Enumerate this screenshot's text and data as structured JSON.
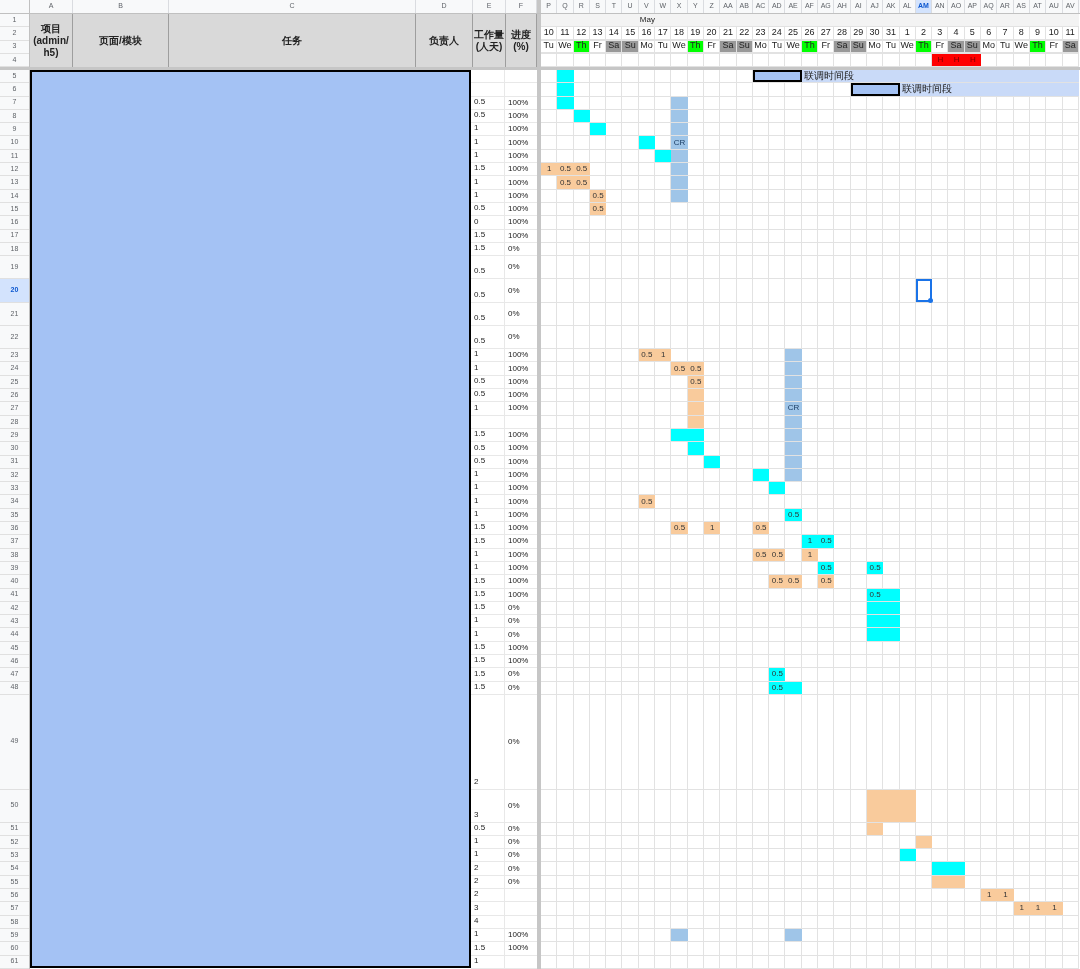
{
  "columns": [
    {
      "label": "A",
      "selected": false
    },
    {
      "label": "B",
      "selected": false
    },
    {
      "label": "C",
      "selected": false
    },
    {
      "label": "D",
      "selected": false
    },
    {
      "label": "E",
      "selected": false
    },
    {
      "label": "F",
      "selected": false
    },
    {
      "label": "P",
      "selected": false
    },
    {
      "label": "Q",
      "selected": false
    },
    {
      "label": "R",
      "selected": false
    },
    {
      "label": "S",
      "selected": false
    },
    {
      "label": "T",
      "selected": false
    },
    {
      "label": "U",
      "selected": false
    },
    {
      "label": "V",
      "selected": false
    },
    {
      "label": "W",
      "selected": false
    },
    {
      "label": "X",
      "selected": false
    },
    {
      "label": "Y",
      "selected": false
    },
    {
      "label": "Z",
      "selected": false
    },
    {
      "label": "AA",
      "selected": false
    },
    {
      "label": "AB",
      "selected": false
    },
    {
      "label": "AC",
      "selected": false
    },
    {
      "label": "AD",
      "selected": false
    },
    {
      "label": "AE",
      "selected": false
    },
    {
      "label": "AF",
      "selected": false
    },
    {
      "label": "AG",
      "selected": false
    },
    {
      "label": "AH",
      "selected": false
    },
    {
      "label": "AI",
      "selected": false
    },
    {
      "label": "AJ",
      "selected": false
    },
    {
      "label": "AK",
      "selected": false
    },
    {
      "label": "AL",
      "selected": false
    },
    {
      "label": "AM",
      "selected": true
    },
    {
      "label": "AN",
      "selected": false
    },
    {
      "label": "AO",
      "selected": false
    },
    {
      "label": "AP",
      "selected": false
    },
    {
      "label": "AQ",
      "selected": false
    },
    {
      "label": "AR",
      "selected": false
    },
    {
      "label": "AS",
      "selected": false
    },
    {
      "label": "AT",
      "selected": false
    },
    {
      "label": "AU",
      "selected": false
    },
    {
      "label": "AV",
      "selected": false
    }
  ],
  "header_row_numbers": [
    "1",
    "2",
    "3",
    "4"
  ],
  "header": [
    "项目\n(admin/\nh5)",
    "页面/模块",
    "任务",
    "负责人",
    "工作量\n(人天)",
    "进度\n(%)"
  ],
  "days": [
    {
      "day": "10",
      "weekday": "Tu"
    },
    {
      "day": "11",
      "weekday": "We"
    },
    {
      "day": "12",
      "weekday": "Th",
      "color": "#00ff00"
    },
    {
      "day": "13",
      "weekday": "Fr"
    },
    {
      "day": "14",
      "weekday": "Sa",
      "color": "#999999"
    },
    {
      "day": "15",
      "weekday": "Su",
      "color": "#999999"
    },
    {
      "day": "16",
      "weekday": "Mo",
      "month": "May"
    },
    {
      "day": "17",
      "weekday": "Tu"
    },
    {
      "day": "18",
      "weekday": "We"
    },
    {
      "day": "19",
      "weekday": "Th",
      "color": "#00ff00"
    },
    {
      "day": "20",
      "weekday": "Fr"
    },
    {
      "day": "21",
      "weekday": "Sa",
      "color": "#999999"
    },
    {
      "day": "22",
      "weekday": "Su",
      "color": "#999999"
    },
    {
      "day": "23",
      "weekday": "Mo"
    },
    {
      "day": "24",
      "weekday": "Tu"
    },
    {
      "day": "25",
      "weekday": "We"
    },
    {
      "day": "26",
      "weekday": "Th",
      "color": "#00ff00"
    },
    {
      "day": "27",
      "weekday": "Fr"
    },
    {
      "day": "28",
      "weekday": "Sa",
      "color": "#999999"
    },
    {
      "day": "29",
      "weekday": "Su",
      "color": "#999999"
    },
    {
      "day": "30",
      "weekday": "Mo"
    },
    {
      "day": "31",
      "weekday": "Tu"
    },
    {
      "day": "1",
      "weekday": "We"
    },
    {
      "day": "2",
      "weekday": "Th",
      "color": "#00ff00"
    },
    {
      "day": "3",
      "weekday": "Fr",
      "holiday": "H"
    },
    {
      "day": "4",
      "weekday": "Sa",
      "color": "#999999",
      "holiday": "H"
    },
    {
      "day": "5",
      "weekday": "Su",
      "color": "#999999",
      "holiday": "H"
    },
    {
      "day": "6",
      "weekday": "Mo"
    },
    {
      "day": "7",
      "weekday": "Tu"
    },
    {
      "day": "8",
      "weekday": "We"
    },
    {
      "day": "9",
      "weekday": "Th",
      "color": "#00ff00"
    },
    {
      "day": "10",
      "weekday": "Fr"
    },
    {
      "day": "11",
      "weekday": "Sa",
      "color": "#999999"
    }
  ],
  "rows": [
    {
      "number": "5",
      "selected": false,
      "cells": [
        null,
        {
          "kind": "task",
          "color": "#00ffff"
        },
        null,
        null,
        null,
        null,
        null,
        null,
        null,
        null,
        null,
        null,
        null,
        {
          "kind": "box"
        },
        {
          "kind": "box"
        },
        {
          "kind": "box"
        },
        {
          "kind": "band",
          "text": "联调时间段"
        }
      ]
    },
    {
      "number": "6",
      "selected": false,
      "cells": [
        null,
        {
          "kind": "task",
          "color": "#00ffff"
        },
        null,
        null,
        null,
        null,
        null,
        null,
        null,
        null,
        null,
        null,
        null,
        null,
        null,
        null,
        null,
        null,
        null,
        {
          "kind": "box"
        },
        {
          "kind": "box"
        },
        {
          "kind": "box"
        },
        {
          "kind": "band",
          "text": "联调时间段"
        }
      ]
    },
    {
      "number": "7",
      "selected": false,
      "workload": "0.5",
      "progress": "100%",
      "cells": [
        null,
        {
          "kind": "task",
          "color": "#00ffff"
        },
        null,
        null,
        null,
        null,
        null,
        null,
        {
          "kind": "task",
          "color": "#9fc5e8"
        }
      ]
    },
    {
      "number": "8",
      "selected": false,
      "workload": "0.5",
      "progress": "100%",
      "cells": [
        null,
        null,
        {
          "kind": "task",
          "color": "#00ffff"
        },
        null,
        null,
        null,
        null,
        null,
        {
          "kind": "task",
          "color": "#9fc5e8"
        }
      ]
    },
    {
      "number": "9",
      "selected": false,
      "workload": "1",
      "progress": "100%",
      "cells": [
        null,
        null,
        null,
        {
          "kind": "task",
          "color": "#00ffff"
        },
        null,
        null,
        null,
        null,
        {
          "kind": "task",
          "color": "#9fc5e8"
        }
      ]
    },
    {
      "number": "10",
      "selected": false,
      "workload": "1",
      "progress": "100%",
      "cells": [
        null,
        null,
        null,
        null,
        null,
        null,
        {
          "kind": "task",
          "color": "#00ffff"
        },
        null,
        {
          "kind": "task",
          "color": "#9fc5e8",
          "text": "CR"
        }
      ]
    },
    {
      "number": "11",
      "selected": false,
      "workload": "1",
      "progress": "100%",
      "cells": [
        null,
        null,
        null,
        null,
        null,
        null,
        null,
        {
          "kind": "task",
          "color": "#00ffff"
        },
        {
          "kind": "task",
          "color": "#9fc5e8"
        }
      ]
    },
    {
      "number": "12",
      "selected": false,
      "workload": "1.5",
      "progress": "100%",
      "cells": [
        {
          "kind": "task",
          "color": "#f9cb9c",
          "text": "1"
        },
        {
          "kind": "task",
          "color": "#f9cb9c",
          "text": "0.5"
        },
        {
          "kind": "task",
          "color": "#f9cb9c",
          "text": "0.5"
        },
        null,
        null,
        null,
        null,
        null,
        {
          "kind": "task",
          "color": "#9fc5e8"
        }
      ]
    },
    {
      "number": "13",
      "selected": false,
      "workload": "1",
      "progress": "100%",
      "cells": [
        null,
        {
          "kind": "task",
          "color": "#f9cb9c",
          "text": "0.5"
        },
        {
          "kind": "task",
          "color": "#f9cb9c",
          "text": "0.5"
        },
        null,
        null,
        null,
        null,
        null,
        {
          "kind": "task",
          "color": "#9fc5e8"
        }
      ]
    },
    {
      "number": "14",
      "selected": false,
      "workload": "1",
      "progress": "100%",
      "cells": [
        null,
        null,
        null,
        {
          "kind": "task",
          "color": "#f9cb9c",
          "text": "0.5"
        },
        null,
        null,
        null,
        null,
        {
          "kind": "task",
          "color": "#9fc5e8"
        }
      ]
    },
    {
      "number": "15",
      "selected": false,
      "workload": "0.5",
      "progress": "100%",
      "cells": [
        null,
        null,
        null,
        {
          "kind": "task",
          "color": "#f9cb9c",
          "text": "0.5"
        }
      ]
    },
    {
      "number": "16",
      "selected": false,
      "workload": "0",
      "progress": "100%"
    },
    {
      "number": "17",
      "selected": false,
      "workload": "1.5",
      "progress": "100%"
    },
    {
      "number": "18",
      "selected": false,
      "workload": "1.5",
      "progress": "0%"
    },
    {
      "number": "19",
      "selected": false,
      "workload": "0.5",
      "progress": "0%"
    },
    {
      "number": "20",
      "selected": true,
      "workload": "0.5",
      "progress": "0%"
    },
    {
      "number": "21",
      "selected": false,
      "workload": "0.5",
      "progress": "0%"
    },
    {
      "number": "22",
      "selected": false,
      "workload": "0.5",
      "progress": "0%"
    },
    {
      "number": "23",
      "selected": false,
      "workload": "1",
      "progress": "100%",
      "cells": [
        null,
        null,
        null,
        null,
        null,
        null,
        {
          "kind": "task",
          "color": "#f9cb9c",
          "text": "0.5"
        },
        {
          "kind": "task",
          "color": "#f9cb9c",
          "text": "1"
        },
        null,
        null,
        null,
        null,
        null,
        null,
        null,
        {
          "kind": "task",
          "color": "#9fc5e8"
        }
      ]
    },
    {
      "number": "24",
      "selected": false,
      "workload": "1",
      "progress": "100%",
      "cells": [
        null,
        null,
        null,
        null,
        null,
        null,
        null,
        null,
        {
          "kind": "task",
          "color": "#f9cb9c",
          "text": "0.5"
        },
        {
          "kind": "task",
          "color": "#f9cb9c",
          "text": "0.5"
        },
        null,
        null,
        null,
        null,
        null,
        {
          "kind": "task",
          "color": "#9fc5e8"
        }
      ]
    },
    {
      "number": "25",
      "selected": false,
      "workload": "0.5",
      "progress": "100%",
      "cells": [
        null,
        null,
        null,
        null,
        null,
        null,
        null,
        null,
        null,
        {
          "kind": "task",
          "color": "#f9cb9c",
          "text": "0.5"
        },
        null,
        null,
        null,
        null,
        null,
        {
          "kind": "task",
          "color": "#9fc5e8"
        }
      ]
    },
    {
      "number": "26",
      "selected": false,
      "workload": "0.5",
      "progress": "100%",
      "cells": [
        null,
        null,
        null,
        null,
        null,
        null,
        null,
        null,
        null,
        {
          "kind": "task",
          "color": "#f9cb9c"
        },
        null,
        null,
        null,
        null,
        null,
        {
          "kind": "task",
          "color": "#9fc5e8"
        }
      ]
    },
    {
      "number": "27",
      "selected": false,
      "workload": "1",
      "progress": "100%",
      "cells": [
        null,
        null,
        null,
        null,
        null,
        null,
        null,
        null,
        null,
        {
          "kind": "task",
          "color": "#f9cb9c"
        },
        null,
        null,
        null,
        null,
        null,
        {
          "kind": "task",
          "color": "#9fc5e8",
          "text": "CR"
        }
      ]
    },
    {
      "number": "28",
      "selected": false,
      "cells": [
        null,
        null,
        null,
        null,
        null,
        null,
        null,
        null,
        null,
        {
          "kind": "task",
          "color": "#f9cb9c"
        },
        null,
        null,
        null,
        null,
        null,
        {
          "kind": "task",
          "color": "#9fc5e8"
        }
      ]
    },
    {
      "number": "29",
      "selected": false,
      "workload": "1.5",
      "progress": "100%",
      "cells": [
        null,
        null,
        null,
        null,
        null,
        null,
        null,
        null,
        {
          "kind": "task",
          "color": "#00ffff"
        },
        {
          "kind": "task",
          "color": "#00ffff"
        },
        null,
        null,
        null,
        null,
        null,
        {
          "kind": "task",
          "color": "#9fc5e8"
        }
      ]
    },
    {
      "number": "30",
      "selected": false,
      "workload": "0.5",
      "progress": "100%",
      "cells": [
        null,
        null,
        null,
        null,
        null,
        null,
        null,
        null,
        null,
        {
          "kind": "task",
          "color": "#00ffff"
        },
        null,
        null,
        null,
        null,
        null,
        {
          "kind": "task",
          "color": "#9fc5e8"
        }
      ]
    },
    {
      "number": "31",
      "selected": false,
      "workload": "0.5",
      "progress": "100%",
      "cells": [
        null,
        null,
        null,
        null,
        null,
        null,
        null,
        null,
        null,
        null,
        {
          "kind": "task",
          "color": "#00ffff"
        },
        null,
        null,
        null,
        null,
        {
          "kind": "task",
          "color": "#9fc5e8"
        }
      ]
    },
    {
      "number": "32",
      "selected": false,
      "workload": "1",
      "progress": "100%",
      "cells": [
        null,
        null,
        null,
        null,
        null,
        null,
        null,
        null,
        null,
        null,
        null,
        null,
        null,
        {
          "kind": "task",
          "color": "#00ffff"
        },
        null,
        {
          "kind": "task",
          "color": "#9fc5e8"
        }
      ]
    },
    {
      "number": "33",
      "selected": false,
      "workload": "1",
      "progress": "100%",
      "cells": [
        null,
        null,
        null,
        null,
        null,
        null,
        null,
        null,
        null,
        null,
        null,
        null,
        null,
        null,
        {
          "kind": "task",
          "color": "#00ffff"
        }
      ]
    },
    {
      "number": "34",
      "selected": false,
      "workload": "1",
      "progress": "100%",
      "cells": [
        null,
        null,
        null,
        null,
        null,
        null,
        {
          "kind": "task",
          "color": "#f9cb9c",
          "text": "0.5"
        }
      ]
    },
    {
      "number": "35",
      "selected": false,
      "workload": "1",
      "progress": "100%",
      "cells": [
        null,
        null,
        null,
        null,
        null,
        null,
        null,
        null,
        null,
        null,
        null,
        null,
        null,
        null,
        null,
        {
          "kind": "task",
          "color": "#00ffff",
          "text": "0.5"
        }
      ]
    },
    {
      "number": "36",
      "selected": false,
      "workload": "1.5",
      "progress": "100%",
      "cells": [
        null,
        null,
        null,
        null,
        null,
        null,
        null,
        null,
        {
          "kind": "task",
          "color": "#f9cb9c",
          "text": "0.5"
        },
        null,
        {
          "kind": "task",
          "color": "#f9cb9c",
          "text": "1"
        },
        null,
        null,
        {
          "kind": "task",
          "color": "#f9cb9c",
          "text": "0.5"
        }
      ]
    },
    {
      "number": "37",
      "selected": false,
      "workload": "1.5",
      "progress": "100%",
      "cells": [
        null,
        null,
        null,
        null,
        null,
        null,
        null,
        null,
        null,
        null,
        null,
        null,
        null,
        null,
        null,
        null,
        {
          "kind": "task",
          "color": "#00ffff",
          "text": "1"
        },
        {
          "kind": "task",
          "color": "#00ffff",
          "text": "0.5"
        }
      ]
    },
    {
      "number": "38",
      "selected": false,
      "workload": "1",
      "progress": "100%",
      "cells": [
        null,
        null,
        null,
        null,
        null,
        null,
        null,
        null,
        null,
        null,
        null,
        null,
        null,
        {
          "kind": "task",
          "color": "#f9cb9c",
          "text": "0.5"
        },
        {
          "kind": "task",
          "color": "#f9cb9c",
          "text": "0.5"
        },
        null,
        {
          "kind": "task",
          "color": "#f9cb9c",
          "text": "1"
        }
      ]
    },
    {
      "number": "39",
      "selected": false,
      "workload": "1",
      "progress": "100%",
      "cells": [
        null,
        null,
        null,
        null,
        null,
        null,
        null,
        null,
        null,
        null,
        null,
        null,
        null,
        null,
        null,
        null,
        null,
        {
          "kind": "task",
          "color": "#00ffff",
          "text": "0.5"
        },
        null,
        null,
        {
          "kind": "task",
          "color": "#00ffff",
          "text": "0.5"
        }
      ]
    },
    {
      "number": "40",
      "selected": false,
      "workload": "1.5",
      "progress": "100%",
      "cells": [
        null,
        null,
        null,
        null,
        null,
        null,
        null,
        null,
        null,
        null,
        null,
        null,
        null,
        null,
        {
          "kind": "task",
          "color": "#f9cb9c",
          "text": "0.5"
        },
        {
          "kind": "task",
          "color": "#f9cb9c",
          "text": "0.5"
        },
        null,
        {
          "kind": "task",
          "color": "#f9cb9c",
          "text": "0.5"
        }
      ]
    },
    {
      "number": "41",
      "selected": false,
      "workload": "1.5",
      "progress": "100%",
      "cells": [
        null,
        null,
        null,
        null,
        null,
        null,
        null,
        null,
        null,
        null,
        null,
        null,
        null,
        null,
        null,
        null,
        null,
        null,
        null,
        null,
        {
          "kind": "task",
          "color": "#00ffff",
          "text": "0.5"
        },
        {
          "kind": "task",
          "color": "#00ffff"
        }
      ]
    },
    {
      "number": "42",
      "selected": false,
      "workload": "1.5",
      "progress": "0%",
      "cells": [
        null,
        null,
        null,
        null,
        null,
        null,
        null,
        null,
        null,
        null,
        null,
        null,
        null,
        null,
        null,
        null,
        null,
        null,
        null,
        null,
        {
          "kind": "task",
          "color": "#00ffff"
        },
        {
          "kind": "task",
          "color": "#00ffff"
        }
      ]
    },
    {
      "number": "43",
      "selected": false,
      "workload": "1",
      "progress": "0%",
      "cells": [
        null,
        null,
        null,
        null,
        null,
        null,
        null,
        null,
        null,
        null,
        null,
        null,
        null,
        null,
        null,
        null,
        null,
        null,
        null,
        null,
        {
          "kind": "task",
          "color": "#00ffff"
        },
        {
          "kind": "task",
          "color": "#00ffff"
        }
      ]
    },
    {
      "number": "44",
      "selected": false,
      "workload": "1",
      "progress": "0%",
      "cells": [
        null,
        null,
        null,
        null,
        null,
        null,
        null,
        null,
        null,
        null,
        null,
        null,
        null,
        null,
        null,
        null,
        null,
        null,
        null,
        null,
        {
          "kind": "task",
          "color": "#00ffff"
        },
        {
          "kind": "task",
          "color": "#00ffff"
        }
      ]
    },
    {
      "number": "45",
      "selected": false,
      "workload": "1.5",
      "progress": "100%"
    },
    {
      "number": "46",
      "selected": false,
      "workload": "1.5",
      "progress": "100%"
    },
    {
      "number": "47",
      "selected": false,
      "workload": "1.5",
      "progress": "0%",
      "cells": [
        null,
        null,
        null,
        null,
        null,
        null,
        null,
        null,
        null,
        null,
        null,
        null,
        null,
        null,
        {
          "kind": "task",
          "color": "#00ffff",
          "text": "0.5"
        }
      ]
    },
    {
      "number": "48",
      "selected": false,
      "workload": "1.5",
      "progress": "0%",
      "cells": [
        null,
        null,
        null,
        null,
        null,
        null,
        null,
        null,
        null,
        null,
        null,
        null,
        null,
        null,
        {
          "kind": "task",
          "color": "#00ffff",
          "text": "0.5"
        },
        {
          "kind": "task",
          "color": "#00ffff"
        }
      ]
    },
    {
      "number": "49",
      "selected": false,
      "workload": "2",
      "progress": "0%"
    },
    {
      "number": "50",
      "selected": false,
      "workload": "3",
      "progress": "0%",
      "cells": [
        null,
        null,
        null,
        null,
        null,
        null,
        null,
        null,
        null,
        null,
        null,
        null,
        null,
        null,
        null,
        null,
        null,
        null,
        null,
        null,
        {
          "kind": "task",
          "color": "#f9cb9c"
        },
        {
          "kind": "task",
          "color": "#f9cb9c"
        },
        {
          "kind": "task",
          "color": "#f9cb9c"
        }
      ]
    },
    {
      "number": "51",
      "selected": false,
      "workload": "0.5",
      "progress": "0%",
      "cells": [
        null,
        null,
        null,
        null,
        null,
        null,
        null,
        null,
        null,
        null,
        null,
        null,
        null,
        null,
        null,
        null,
        null,
        null,
        null,
        null,
        {
          "kind": "task",
          "color": "#f9cb9c"
        }
      ]
    },
    {
      "number": "52",
      "selected": false,
      "workload": "1",
      "progress": "0%",
      "cells": [
        null,
        null,
        null,
        null,
        null,
        null,
        null,
        null,
        null,
        null,
        null,
        null,
        null,
        null,
        null,
        null,
        null,
        null,
        null,
        null,
        null,
        null,
        null,
        {
          "kind": "task",
          "color": "#f9cb9c"
        }
      ]
    },
    {
      "number": "53",
      "selected": false,
      "workload": "1",
      "progress": "0%",
      "cells": [
        null,
        null,
        null,
        null,
        null,
        null,
        null,
        null,
        null,
        null,
        null,
        null,
        null,
        null,
        null,
        null,
        null,
        null,
        null,
        null,
        null,
        null,
        {
          "kind": "task",
          "color": "#00ffff"
        }
      ]
    },
    {
      "number": "54",
      "selected": false,
      "workload": "2",
      "progress": "0%",
      "cells": [
        null,
        null,
        null,
        null,
        null,
        null,
        null,
        null,
        null,
        null,
        null,
        null,
        null,
        null,
        null,
        null,
        null,
        null,
        null,
        null,
        null,
        null,
        null,
        null,
        {
          "kind": "task",
          "color": "#00ffff"
        },
        {
          "kind": "task",
          "color": "#00ffff"
        }
      ]
    },
    {
      "number": "55",
      "selected": false,
      "workload": "2",
      "progress": "0%",
      "cells": [
        null,
        null,
        null,
        null,
        null,
        null,
        null,
        null,
        null,
        null,
        null,
        null,
        null,
        null,
        null,
        null,
        null,
        null,
        null,
        null,
        null,
        null,
        null,
        null,
        {
          "kind": "task",
          "color": "#f9cb9c"
        },
        {
          "kind": "task",
          "color": "#f9cb9c"
        }
      ]
    },
    {
      "number": "56",
      "selected": false,
      "workload": "2",
      "cells": [
        null,
        null,
        null,
        null,
        null,
        null,
        null,
        null,
        null,
        null,
        null,
        null,
        null,
        null,
        null,
        null,
        null,
        null,
        null,
        null,
        null,
        null,
        null,
        null,
        null,
        null,
        null,
        {
          "kind": "task",
          "color": "#f9cb9c",
          "text": "1"
        },
        {
          "kind": "task",
          "color": "#f9cb9c",
          "text": "1"
        }
      ]
    },
    {
      "number": "57",
      "selected": false,
      "workload": "3",
      "cells": [
        null,
        null,
        null,
        null,
        null,
        null,
        null,
        null,
        null,
        null,
        null,
        null,
        null,
        null,
        null,
        null,
        null,
        null,
        null,
        null,
        null,
        null,
        null,
        null,
        null,
        null,
        null,
        null,
        null,
        {
          "kind": "task",
          "color": "#f9cb9c",
          "text": "1"
        },
        {
          "kind": "task",
          "color": "#f9cb9c",
          "text": "1"
        },
        {
          "kind": "task",
          "color": "#f9cb9c",
          "text": "1"
        }
      ]
    },
    {
      "number": "58",
      "selected": false,
      "workload": "4"
    },
    {
      "number": "59",
      "selected": false,
      "workload": "1",
      "progress": "100%",
      "cells": [
        null,
        null,
        null,
        null,
        null,
        null,
        null,
        null,
        {
          "kind": "task",
          "color": "#9fc5e8"
        },
        null,
        null,
        null,
        null,
        null,
        null,
        {
          "kind": "task",
          "color": "#9fc5e8"
        }
      ]
    },
    {
      "number": "60",
      "selected": false,
      "workload": "1.5",
      "progress": "100%"
    },
    {
      "number": "61",
      "selected": false,
      "workload": "1"
    }
  ]
}
